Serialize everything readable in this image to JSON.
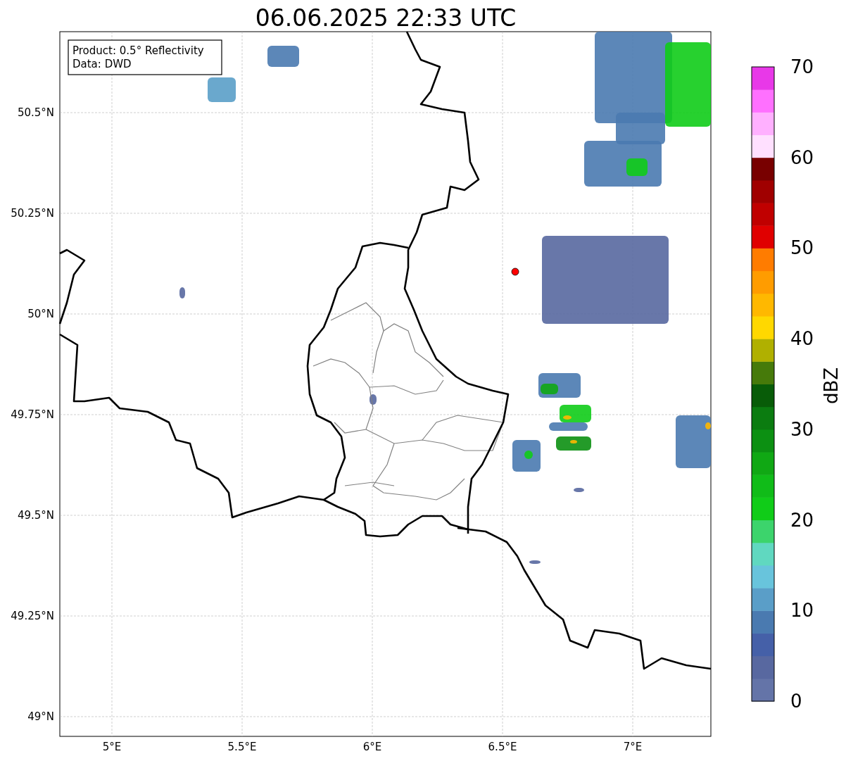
{
  "title": "06.06.2025 22:33 UTC",
  "info_box": {
    "lines": [
      "Product: 0.5° Reflectivity",
      "Data: DWD"
    ]
  },
  "y_ticks": [
    "50.5°N",
    "50.25°N",
    "50°N",
    "49.75°N",
    "49.5°N",
    "49.25°N",
    "49°N"
  ],
  "x_ticks": [
    "5°E",
    "5.5°E",
    "6°E",
    "6.5°E",
    "7°E"
  ],
  "colorbar": {
    "label": "dBZ",
    "ticks": [
      "70",
      "60",
      "50",
      "40",
      "30",
      "20",
      "10",
      "0"
    ],
    "segments": [
      {
        "color": "#6474a8"
      },
      {
        "color": "#5868a0"
      },
      {
        "color": "#4560a8"
      },
      {
        "color": "#4a7ab0"
      },
      {
        "color": "#5a9ec8"
      },
      {
        "color": "#68c4dc"
      },
      {
        "color": "#60d8c0"
      },
      {
        "color": "#3cd46c"
      },
      {
        "color": "#10cc18"
      },
      {
        "color": "#10bc18"
      },
      {
        "color": "#10a814"
      },
      {
        "color": "#0c9012"
      },
      {
        "color": "#0b7c10"
      },
      {
        "color": "#085c08"
      },
      {
        "color": "#467a0a"
      },
      {
        "color": "#b0b000"
      },
      {
        "color": "#ffd800"
      },
      {
        "color": "#ffb800"
      },
      {
        "color": "#ff9c00"
      },
      {
        "color": "#ff7c00"
      },
      {
        "color": "#e00000"
      },
      {
        "color": "#c00000"
      },
      {
        "color": "#a00000"
      },
      {
        "color": "#780000"
      },
      {
        "color": "#ffe0ff"
      },
      {
        "color": "#ffb0ff"
      },
      {
        "color": "#ff70ff"
      },
      {
        "color": "#e838e8"
      }
    ]
  }
}
